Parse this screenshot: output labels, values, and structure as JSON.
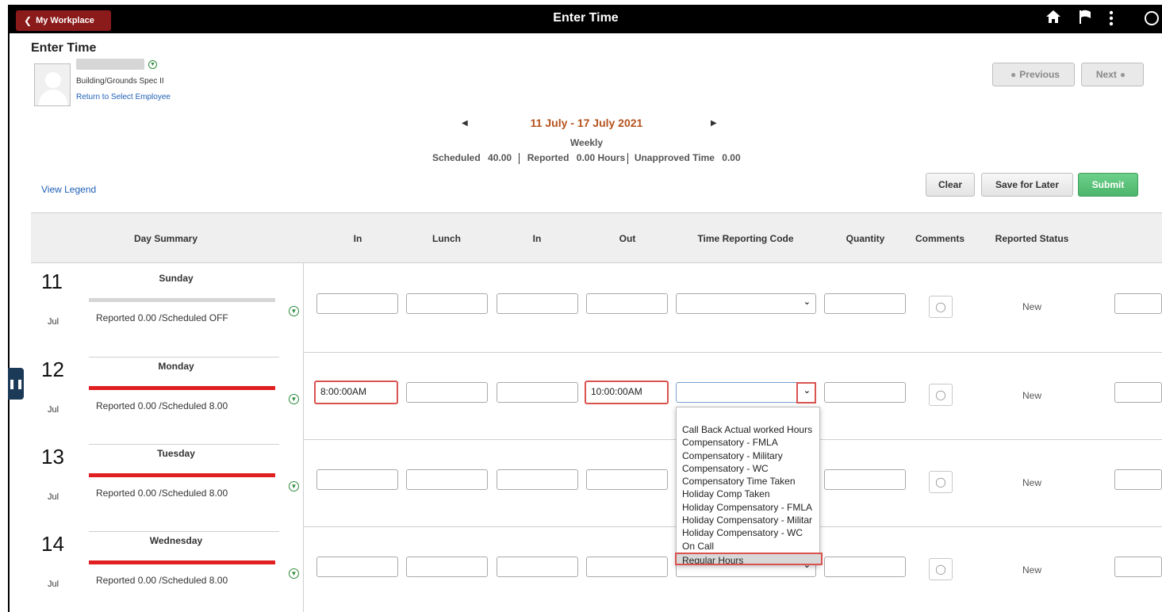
{
  "topbar": {
    "back_label": "My Workplace",
    "title": "Enter Time",
    "icons": [
      "home-icon",
      "flag-icon",
      "more-icon",
      "info-icon"
    ]
  },
  "page": {
    "title": "Enter Time"
  },
  "employee": {
    "job_title": "Building/Grounds Spec II",
    "return_link": "Return to Select Employee"
  },
  "nav": {
    "previous_label": "Previous",
    "next_label": "Next"
  },
  "period": {
    "range": "11 July - 17 July 2021",
    "frequency": "Weekly",
    "scheduled_label": "Scheduled",
    "scheduled_value": "40.00",
    "reported_label": "Reported",
    "reported_value": "0.00 Hours",
    "unapproved_label": "Unapproved Time",
    "unapproved_value": "0.00"
  },
  "links": {
    "view_legend": "View Legend"
  },
  "actions": {
    "clear": "Clear",
    "save_for_later": "Save for Later",
    "submit": "Submit"
  },
  "columns": {
    "day_summary": "Day Summary",
    "in": "In",
    "lunch": "Lunch",
    "in2": "In",
    "out": "Out",
    "trc": "Time Reporting Code",
    "quantity": "Quantity",
    "comments": "Comments",
    "status": "Reported Status"
  },
  "days": [
    {
      "num": "11",
      "mon": "Jul",
      "name": "Sunday",
      "summary": "Reported 0.00 /Scheduled OFF",
      "bar_color": "#d6d6d6",
      "in": "",
      "lunch": "",
      "in2": "",
      "out": "",
      "status": "New"
    },
    {
      "num": "12",
      "mon": "Jul",
      "name": "Monday",
      "summary": "Reported 0.00 /Scheduled 8.00",
      "bar_color": "#e02020",
      "in": "8:00:00AM",
      "lunch": "",
      "in2": "",
      "out": "10:00:00AM",
      "status": "New"
    },
    {
      "num": "13",
      "mon": "Jul",
      "name": "Tuesday",
      "summary": "Reported 0.00 /Scheduled 8.00",
      "bar_color": "#e02020",
      "in": "",
      "lunch": "",
      "in2": "",
      "out": "",
      "status": "New"
    },
    {
      "num": "14",
      "mon": "Jul",
      "name": "Wednesday",
      "summary": "Reported 0.00 /Scheduled 8.00",
      "bar_color": "#e02020",
      "in": "",
      "lunch": "",
      "in2": "",
      "out": "",
      "status": "New"
    }
  ],
  "trc_options": [
    "Call Back Actual worked Hours",
    "Compensatory - FMLA",
    "Compensatory - Military",
    "Compensatory - WC",
    "Compensatory Time Taken",
    "Holiday Comp Taken",
    "Holiday Compensatory - FMLA",
    "Holiday Compensatory - Militar",
    "Holiday Compensatory - WC",
    "On Call",
    "Regular Hours"
  ],
  "trc_highlighted": "Regular Hours",
  "colors": {
    "accent_red": "#d9534f",
    "submit_green": "#4cb56c",
    "period_orange": "#b5521c",
    "link_blue": "#1f5fb5"
  }
}
